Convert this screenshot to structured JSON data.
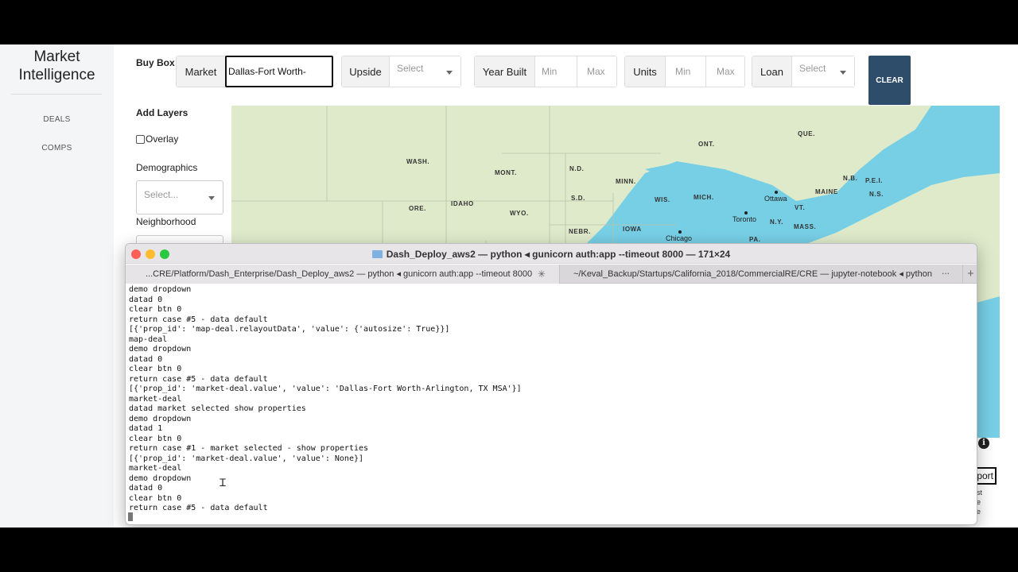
{
  "sidebar": {
    "brand_line1": "Market",
    "brand_line2": "Intelligence",
    "nav": [
      "DEALS",
      "COMPS"
    ]
  },
  "buybox": {
    "label": "Buy Box",
    "market_label": "Market",
    "market_value": "Dallas-Fort Worth-",
    "upside_label": "Upside",
    "upside_placeholder": "Select",
    "yearbuilt_label": "Year Built",
    "yearbuilt_min": "Min",
    "yearbuilt_max": "Max",
    "units_label": "Units",
    "units_min": "Min",
    "units_max": "Max",
    "loan_label": "Loan",
    "loan_placeholder": "Select",
    "clear_label": "CLEAR"
  },
  "layers": {
    "title": "Add Layers",
    "overlay_label": "Overlay",
    "demographics_label": "Demographics",
    "demographics_placeholder": "Select...",
    "neighborhood_label": "Neighborhood"
  },
  "map": {
    "regions": [
      "WASH.",
      "MONT.",
      "N.D.",
      "MINN.",
      "ONT.",
      "QUE.",
      "ORE.",
      "IDAHO",
      "WYO.",
      "S.D.",
      "WIS.",
      "MICH.",
      "MAINE",
      "N.B.",
      "P.E.I.",
      "N.S.",
      "VT.",
      "N.Y.",
      "MASS.",
      "NEBR.",
      "IOWA",
      "PA."
    ],
    "cities": [
      "Ottawa",
      "Toronto",
      "Chicago"
    ],
    "info_icon": "i"
  },
  "export_label": "Export",
  "side_table": [
    "st",
    "e",
    "e"
  ],
  "terminal": {
    "title": "Dash_Deploy_aws2 — python ◂ gunicorn auth:app --timeout 8000 — 171×24",
    "tab1": "...CRE/Platform/Dash_Enterprise/Dash_Deploy_aws2 — python ◂ gunicorn auth:app --timeout 8000",
    "tab2": "~/Keval_Backup/Startups/California_2018/CommercialRE/CRE — jupyter-notebook ◂ python",
    "more": "...",
    "plus": "+",
    "lines": [
      "demo dropdown",
      "datad 0",
      "clear btn 0",
      "return case #5 - data default",
      "[{'prop_id': 'map-deal.relayoutData', 'value': {'autosize': True}}]",
      "map-deal",
      "demo dropdown",
      "datad 0",
      "clear btn 0",
      "return case #5 - data default",
      "[{'prop_id': 'market-deal.value', 'value': 'Dallas-Fort Worth-Arlington, TX MSA'}]",
      "market-deal",
      "datad market selected show properties",
      "demo dropdown",
      "datad 1",
      "clear btn 0",
      "return case #1 - market selected - show properties",
      "[{'prop_id': 'market-deal.value', 'value': None}]",
      "market-deal",
      "demo dropdown",
      "datad 0",
      "clear btn 0",
      "return case #5 - data default"
    ]
  },
  "colors": {
    "clear_button": "#2e4d6b",
    "water": "#77cfe6",
    "land": "#dfeacb",
    "close": "#fe5f57",
    "minimize": "#febc2e",
    "zoom": "#28c840"
  }
}
